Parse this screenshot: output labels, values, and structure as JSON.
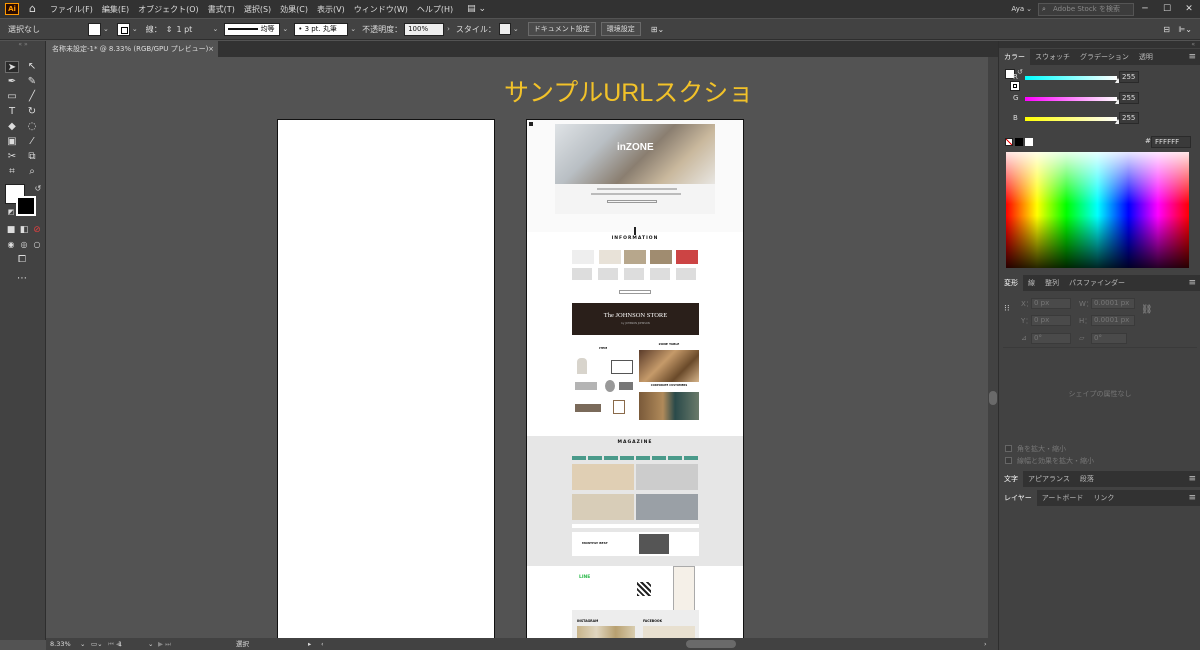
{
  "menubar": {
    "app_logo": "Ai",
    "home_icon": "home-icon",
    "items": [
      "ファイル(F)",
      "編集(E)",
      "オブジェクト(O)",
      "書式(T)",
      "選択(S)",
      "効果(C)",
      "表示(V)",
      "ウィンドウ(W)",
      "ヘルプ(H)"
    ],
    "user": "Aya",
    "stock_search_placeholder": "Adobe Stock を検索"
  },
  "controlbar": {
    "selection_state": "選択なし",
    "stroke_label": "線：",
    "stroke_weight": "1 pt",
    "stroke_profile": "均等",
    "brush": "3 pt. 丸筆",
    "opacity_label": "不透明度：",
    "opacity_value": "100%",
    "style_label": "スタイル：",
    "document_setup_button": "ドキュメント設定",
    "preferences_button": "環境設定"
  },
  "document_tab": {
    "title": "名称未設定-1* @ 8.33% (RGB/GPU プレビュー)",
    "close": "×"
  },
  "canvas": {
    "title_text": "サンプルURLスクショ",
    "title_color": "#f2c229",
    "screenshot": {
      "hero_logo": "inZONE",
      "section_information": "INFORMATION",
      "banner_store": "The JOHNSON STORE",
      "banner_store_sub": "by JOHNSON JOHNSON",
      "label_item": "ITEM",
      "label_table": "ZONE TABLE",
      "label_corporate": "CORPORATE CUSTOMERS",
      "section_magazine": "MAGAZINE",
      "label_monthly_best": "MONTHLY BEST",
      "label_line": "LINE",
      "label_instagram": "INSTAGRAM",
      "label_facebook": "FACEBOOK"
    }
  },
  "statusbar": {
    "zoom": "8.33%",
    "artboard_number": "1",
    "tool_name": "選択"
  },
  "color_panel": {
    "tabs": [
      "カラー",
      "スウォッチ",
      "グラデーション",
      "透明"
    ],
    "active_tab": "カラー",
    "r_label": "R",
    "r_value": "255",
    "g_label": "G",
    "g_value": "255",
    "b_label": "B",
    "b_value": "255",
    "hex_prefix": "#",
    "hex_value": "FFFFFF"
  },
  "transform_panel": {
    "tabs": [
      "変形",
      "線",
      "整列",
      "パスファインダー"
    ],
    "active_tab": "変形",
    "x_label": "X：",
    "x_value": "0 px",
    "y_label": "Y：",
    "y_value": "0 px",
    "w_label": "W：",
    "w_value": "0.0001 px",
    "h_label": "H：",
    "h_value": "0.0001 px",
    "angle_value": "0°",
    "shear_value": "0°",
    "no_shape_props": "シェイプの属性なし",
    "scale_corners": "角を拡大・縮小",
    "scale_strokes": "線幅と効果を拡大・縮小"
  },
  "character_panel": {
    "tabs": [
      "文字",
      "アピアランス",
      "段落"
    ]
  },
  "layers_panel": {
    "tabs": [
      "レイヤー",
      "アートボード",
      "リンク"
    ],
    "active_tab": "レイヤー"
  },
  "colors": {
    "menubar": "#323232",
    "panel": "#424242",
    "canvas": "#535353",
    "accent_title": "#f2c229",
    "slider_r": "#40e0e0",
    "slider_g": "#e040e0",
    "slider_b": "#e0e040"
  }
}
